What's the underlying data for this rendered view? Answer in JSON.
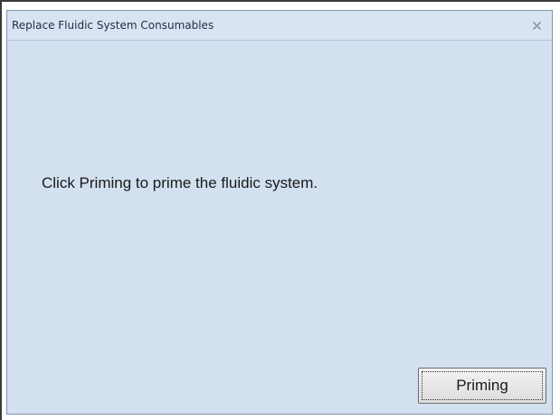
{
  "window": {
    "title": "Replace Fluidic System Consumables",
    "close_icon": "close-icon"
  },
  "main": {
    "message": "Click Priming to prime the fluidic system.",
    "priming_label": "Priming"
  },
  "colors": {
    "background": "#d3e0ef",
    "titlebar": "#d9e4f2",
    "border": "#7f94b0"
  }
}
